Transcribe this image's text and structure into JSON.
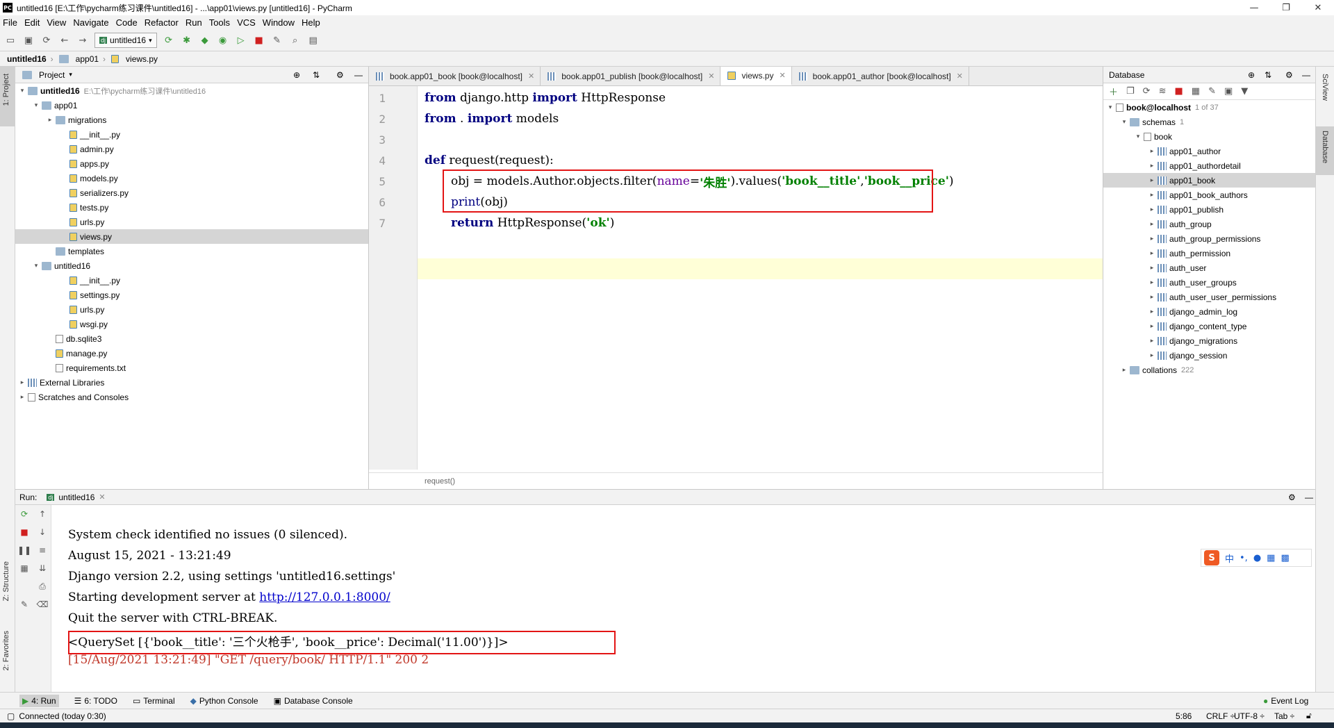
{
  "window": {
    "title": "untitled16 [E:\\工作\\pycharm练习课件\\untitled16] - ...\\app01\\views.py [untitled16] - PyCharm"
  },
  "menu": [
    "File",
    "Edit",
    "View",
    "Navigate",
    "Code",
    "Refactor",
    "Run",
    "Tools",
    "VCS",
    "Window",
    "Help"
  ],
  "toolbar": {
    "run_config": "untitled16"
  },
  "breadcrumb": [
    "untitled16",
    "app01",
    "views.py"
  ],
  "project": {
    "header": "Project",
    "tree": [
      {
        "label": "untitled16",
        "path": "E:\\工作\\pycharm练习课件\\untitled16",
        "indent": 0,
        "arrow": "▾",
        "icon": "folder",
        "bold": true
      },
      {
        "label": "app01",
        "indent": 1,
        "arrow": "▾",
        "icon": "folder"
      },
      {
        "label": "migrations",
        "indent": 2,
        "arrow": "▸",
        "icon": "folder"
      },
      {
        "label": "__init__.py",
        "indent": 3,
        "arrow": "",
        "icon": "py"
      },
      {
        "label": "admin.py",
        "indent": 3,
        "arrow": "",
        "icon": "py"
      },
      {
        "label": "apps.py",
        "indent": 3,
        "arrow": "",
        "icon": "py"
      },
      {
        "label": "models.py",
        "indent": 3,
        "arrow": "",
        "icon": "py"
      },
      {
        "label": "serializers.py",
        "indent": 3,
        "arrow": "",
        "icon": "py"
      },
      {
        "label": "tests.py",
        "indent": 3,
        "arrow": "",
        "icon": "py"
      },
      {
        "label": "urls.py",
        "indent": 3,
        "arrow": "",
        "icon": "py"
      },
      {
        "label": "views.py",
        "indent": 3,
        "arrow": "",
        "icon": "py",
        "selected": true
      },
      {
        "label": "templates",
        "indent": 2,
        "arrow": "",
        "icon": "folder"
      },
      {
        "label": "untitled16",
        "indent": 1,
        "arrow": "▾",
        "icon": "folder"
      },
      {
        "label": "__init__.py",
        "indent": 3,
        "arrow": "",
        "icon": "py"
      },
      {
        "label": "settings.py",
        "indent": 3,
        "arrow": "",
        "icon": "py"
      },
      {
        "label": "urls.py",
        "indent": 3,
        "arrow": "",
        "icon": "py"
      },
      {
        "label": "wsgi.py",
        "indent": 3,
        "arrow": "",
        "icon": "py"
      },
      {
        "label": "db.sqlite3",
        "indent": 2,
        "arrow": "",
        "icon": "db"
      },
      {
        "label": "manage.py",
        "indent": 2,
        "arrow": "",
        "icon": "py"
      },
      {
        "label": "requirements.txt",
        "indent": 2,
        "arrow": "",
        "icon": "txt"
      },
      {
        "label": "External Libraries",
        "indent": 0,
        "arrow": "▸",
        "icon": "lib"
      },
      {
        "label": "Scratches and Consoles",
        "indent": 0,
        "arrow": "▸",
        "icon": "scratch"
      }
    ]
  },
  "editor": {
    "tabs": [
      {
        "label": "book.app01_book [book@localhost]",
        "active": false
      },
      {
        "label": "book.app01_publish [book@localhost]",
        "active": false
      },
      {
        "label": "views.py",
        "active": true
      },
      {
        "label": "book.app01_author [book@localhost]",
        "active": false
      }
    ],
    "line_numbers": [
      "1",
      "2",
      "3",
      "4",
      "5",
      "6",
      "7"
    ],
    "footer": "request()"
  },
  "code": {
    "l1_from": "from",
    "l1_mod": " django.http ",
    "l1_import": "import",
    "l1_name": " HttpResponse",
    "l2_from": "from",
    "l2_mod": " . ",
    "l2_import": "import",
    "l2_name": " models",
    "l4_def": "def",
    "l4_sig": " request(request):",
    "l5_a": "obj = models.Author.objects.filter(",
    "l5_kw": "name",
    "l5_eq": "=",
    "l5_s1": "'朱胜'",
    "l5_b": ").values(",
    "l5_s2": "'book__title'",
    "l5_c": ",",
    "l5_s3": "'book__price'",
    "l5_d": ")",
    "l6_print": "print",
    "l6_arg": "(obj)",
    "l7_return": "return",
    "l7_call": " HttpResponse(",
    "l7_s": "'ok'",
    "l7_end": ")"
  },
  "database": {
    "header": "Database",
    "connection": "book@localhost",
    "connection_count": "1 of 37",
    "schemas_label": "schemas",
    "schemas_count": "1",
    "schema": "book",
    "tables": [
      "app01_author",
      "app01_authordetail",
      "app01_book",
      "app01_book_authors",
      "app01_publish",
      "auth_group",
      "auth_group_permissions",
      "auth_permission",
      "auth_user",
      "auth_user_groups",
      "auth_user_user_permissions",
      "django_admin_log",
      "django_content_type",
      "django_migrations",
      "django_session"
    ],
    "selected_table": "app01_book",
    "collations_label": "collations",
    "collations_count": "222"
  },
  "run": {
    "label": "Run:",
    "tab": "untitled16",
    "output": [
      "System check identified no issues (0 silenced).",
      "August 15, 2021 - 13:21:49",
      "Django version 2.2, using settings 'untitled16.settings'"
    ],
    "server_prefix": "Starting development server at ",
    "server_link": "http://127.0.0.1:8000/",
    "quit": "Quit the server with CTRL-BREAK.",
    "queryset": "<QuerySet [{'book__title': '三个火枪手', 'book__price': Decimal('11.00')}]>",
    "request_log": "[15/Aug/2021 13:21:49] \"GET /query/book/ HTTP/1.1\" 200 2"
  },
  "side_labels": {
    "project": "1: Project",
    "structure": "Z: Structure",
    "favorites": "2: Favorites",
    "sciview": "SciView",
    "database": "Database"
  },
  "bottom_tabs": [
    "4: Run",
    "6: TODO",
    "Terminal",
    "Python Console",
    "Database Console"
  ],
  "event_log": "Event Log",
  "status": {
    "left": "Connected (today 0:30)",
    "position": "5:86",
    "line_sep": "CRLF ÷",
    "encoding": "UTF-8 ÷",
    "indent": "Tab ÷"
  },
  "ime": {
    "lang": "中",
    "punct": "•,"
  },
  "colors": {
    "highlight_box": "#e31414",
    "keyword": "#000080",
    "string": "#008000",
    "link": "#0000cc"
  }
}
